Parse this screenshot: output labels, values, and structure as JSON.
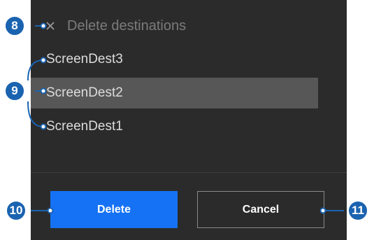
{
  "dialog": {
    "title": "Delete destinations",
    "close_icon": "close-icon"
  },
  "destinations": [
    {
      "label": "ScreenDest3",
      "selected": false
    },
    {
      "label": "ScreenDest2",
      "selected": true
    },
    {
      "label": "ScreenDest1",
      "selected": false
    }
  ],
  "buttons": {
    "delete_label": "Delete",
    "cancel_label": "Cancel"
  },
  "callouts": [
    "8",
    "9",
    "10",
    "11"
  ],
  "colors": {
    "panel_bg": "#2b2b2b",
    "selected_bg": "#575757",
    "primary": "#1672f4",
    "callout": "#1a63b0"
  }
}
